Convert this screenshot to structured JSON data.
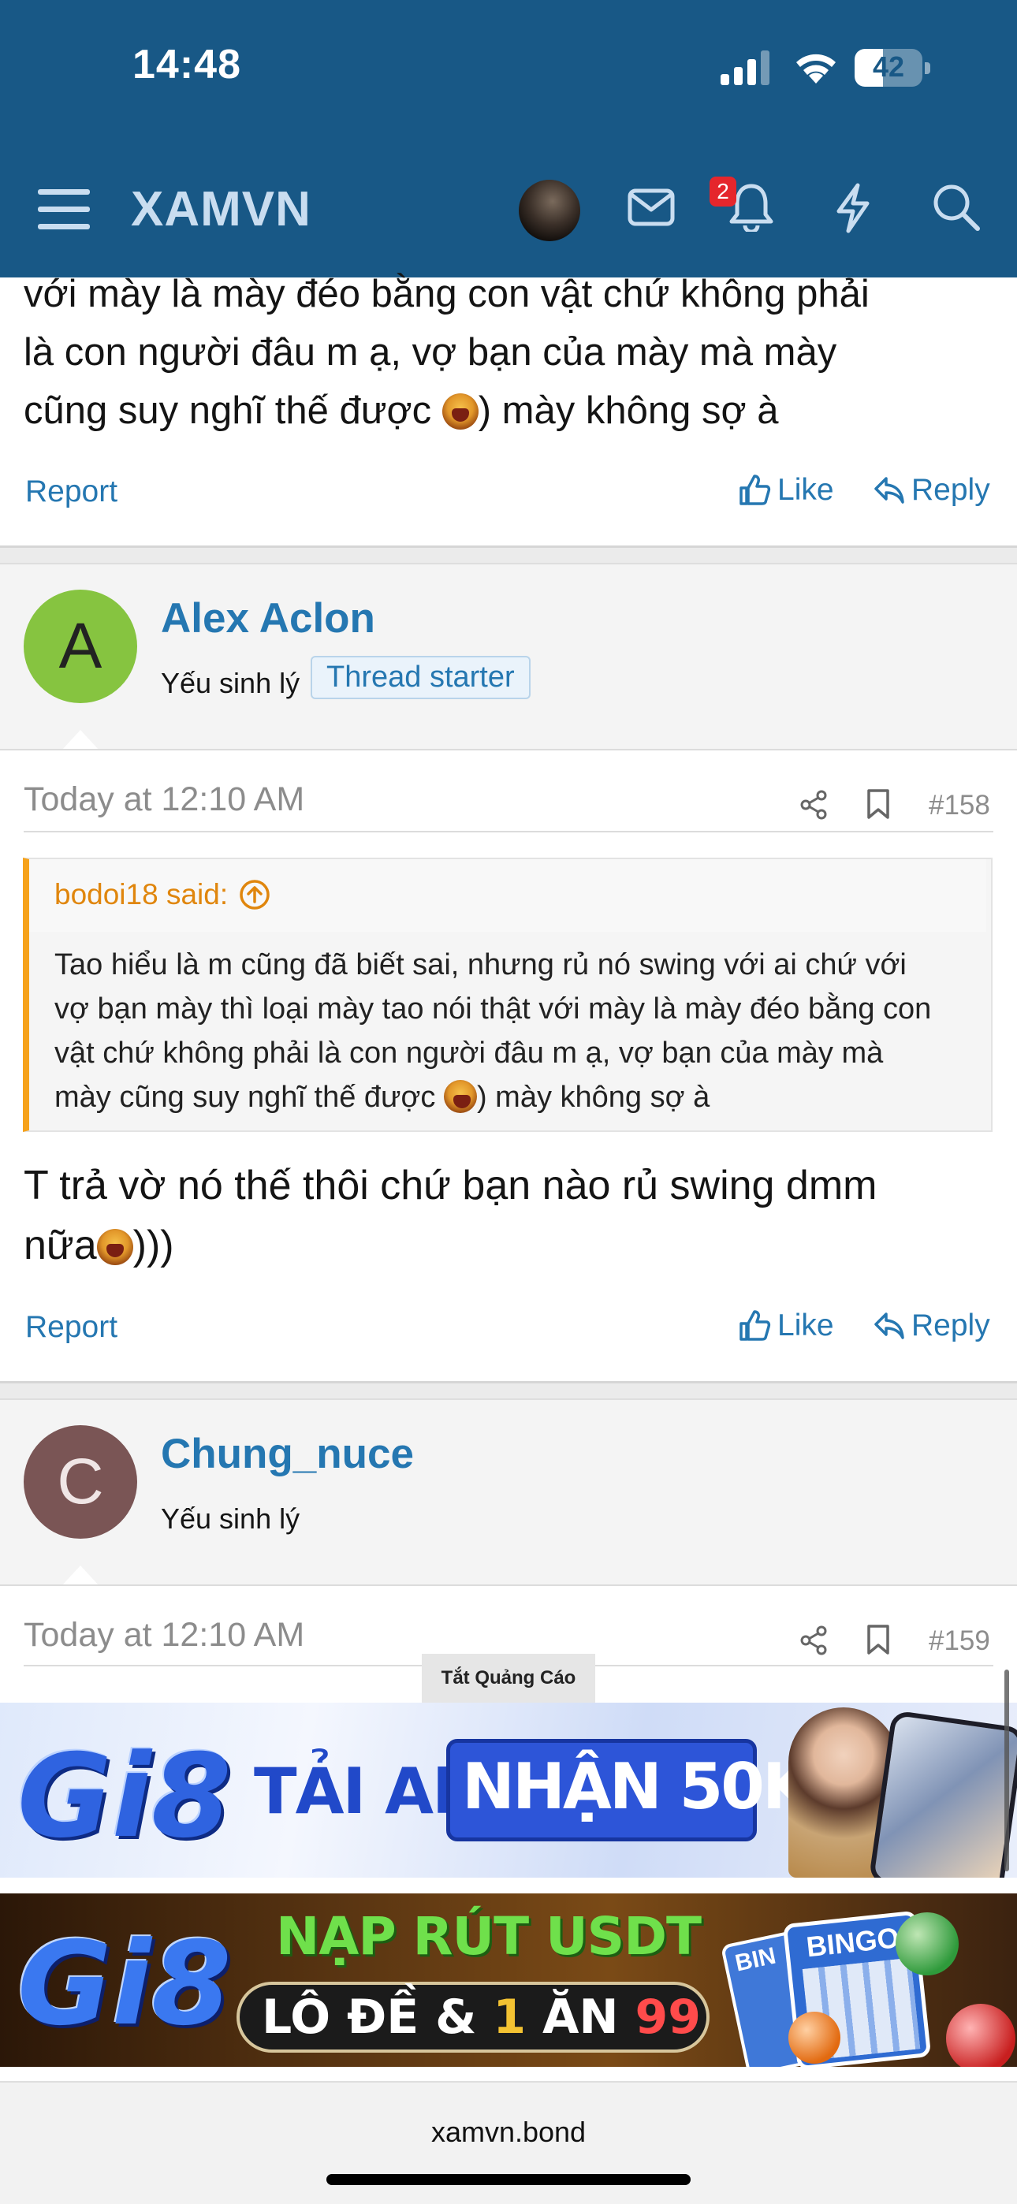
{
  "status_bar": {
    "time": "14:48",
    "battery": "42",
    "battery_level": 0.42
  },
  "header": {
    "logo": "XAMVN",
    "notification_count": "2"
  },
  "posts": [
    {
      "body_lines": [
        "với mày là mày đéo bằng con vật chứ không phải",
        "là con người đâu m ạ, vợ bạn của mày mà mày",
        "cũng suy nghĩ thế được ",
        ") mày không sợ à"
      ],
      "report": "Report",
      "like": "Like",
      "reply": "Reply"
    },
    {
      "avatar_letter": "A",
      "avatar_color": "#86c440",
      "username": "Alex Aclon",
      "user_title": "Yếu sinh lý",
      "badge": "Thread starter",
      "date": "Today at 12:10 AM",
      "post_number": "#158",
      "quote": {
        "author": "bodoi18 said:",
        "lines": [
          "Tao hiểu là m cũng đã biết sai, nhưng rủ nó swing với ai chứ với",
          "vợ bạn mày thì loại mày tao nói thật với mày là mày đéo bằng con",
          "vật chứ không phải là con người đâu m ạ, vợ bạn của mày mà",
          "mày cũng suy nghĩ thế được ",
          ") mày không sợ à"
        ]
      },
      "body_lines": [
        "T trả vờ nó thế thôi chứ bạn nào rủ swing dmm",
        "nữa",
        ")))"
      ],
      "report": "Report",
      "like": "Like",
      "reply": "Reply"
    },
    {
      "avatar_letter": "C",
      "avatar_color": "#7a5555",
      "username": "Chung_nuce",
      "user_title": "Yếu sinh lý",
      "date": "Today at 12:10 AM",
      "post_number": "#159"
    }
  ],
  "ads": {
    "label": "Tắt Quảng Cáo",
    "banner1": {
      "logo": "Gi8",
      "text1": "TẢI APP",
      "text2": "NHẬN 50K"
    },
    "banner2": {
      "logo": "Gi8",
      "text1": "NẠP RÚT USDT",
      "text2_a": "LÔ ĐỀ & ",
      "text2_b": "1",
      "text2_c": " ĂN ",
      "text2_d": "99",
      "bingo": "BINGO",
      "bin": "BIN"
    }
  },
  "browser": {
    "url": "xamvn.bond"
  },
  "colors": {
    "header": "#185886",
    "link": "#2577b1",
    "quote_border": "#f6a21b"
  },
  "icons": [
    "menu-icon",
    "mail-icon",
    "bell-icon",
    "bolt-icon",
    "search-icon",
    "thumbs-up-icon",
    "reply-icon",
    "share-icon",
    "bookmark-icon",
    "arrow-up-circle-icon"
  ]
}
